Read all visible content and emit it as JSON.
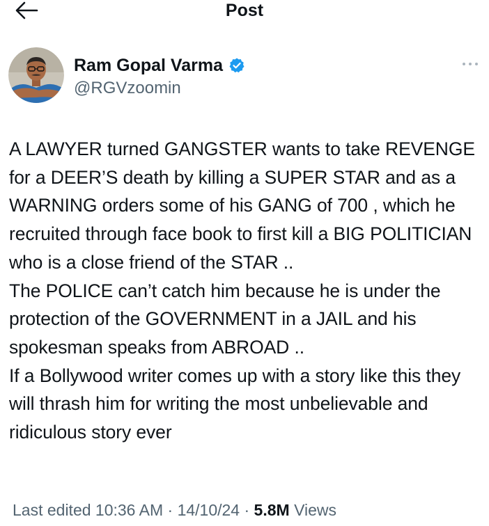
{
  "header": {
    "title": "Post"
  },
  "author": {
    "display_name": "Ram Gopal Varma",
    "handle": "@RGVzoomin",
    "verified": true,
    "verified_color": "#1d9bf0",
    "avatar_icon": "profile-photo"
  },
  "tweet": {
    "text": "A LAWYER turned GANGSTER wants to take REVENGE for a DEER’S death by killing a SUPER STAR and as a WARNING orders some of his GANG of 700 , which he recruited through face book to first kill a BIG POLITICIAN who is a close friend of the STAR ..\nThe POLICE can’t catch him because he is under the protection of the GOVERNMENT in a JAIL and his spokesman speaks from ABROAD ..\nIf a Bollywood writer comes up with a story like this they will thrash him for writing the most unbelievable and ridiculous story ever"
  },
  "meta": {
    "last_edited_label": "Last edited",
    "time": "10:36 AM",
    "separator": "·",
    "date": "14/10/24",
    "views_count": "5.8M",
    "views_label": "Views"
  },
  "colors": {
    "text_primary": "#0f1419",
    "text_secondary": "#536471",
    "accent": "#1d9bf0"
  }
}
